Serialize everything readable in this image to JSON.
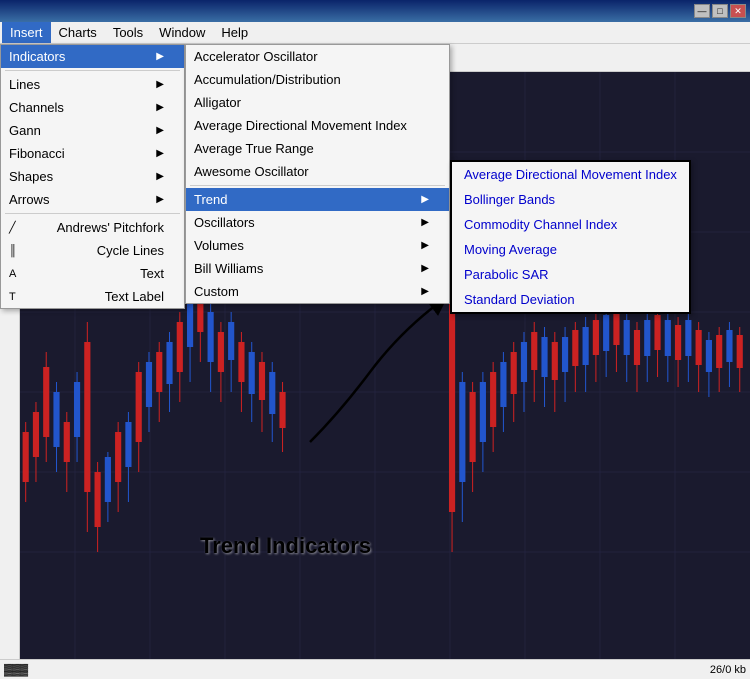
{
  "titleBar": {
    "title": "",
    "controls": {
      "minimize": "—",
      "maximize": "□",
      "close": "✕"
    }
  },
  "menuBar": {
    "items": [
      {
        "id": "insert",
        "label": "Insert",
        "active": true
      },
      {
        "id": "charts",
        "label": "Charts"
      },
      {
        "id": "tools",
        "label": "Tools"
      },
      {
        "id": "window",
        "label": "Window"
      },
      {
        "id": "help",
        "label": "Help"
      }
    ]
  },
  "insertMenu": {
    "items": [
      {
        "id": "indicators",
        "label": "Indicators",
        "hasArrow": true,
        "selected": true
      },
      {
        "id": "sep1",
        "type": "sep"
      },
      {
        "id": "lines",
        "label": "Lines",
        "hasArrow": true
      },
      {
        "id": "channels",
        "label": "Channels",
        "hasArrow": true
      },
      {
        "id": "gann",
        "label": "Gann",
        "hasArrow": true
      },
      {
        "id": "fibonacci",
        "label": "Fibonacci",
        "hasArrow": true
      },
      {
        "id": "shapes",
        "label": "Shapes",
        "hasArrow": true
      },
      {
        "id": "arrows",
        "label": "Arrows",
        "hasArrow": true
      },
      {
        "id": "sep2",
        "type": "sep"
      },
      {
        "id": "pitchfork",
        "label": "Andrews' Pitchfork",
        "icon": "╱"
      },
      {
        "id": "cycle",
        "label": "Cycle Lines",
        "icon": "║"
      },
      {
        "id": "text",
        "label": "Text",
        "icon": "A"
      },
      {
        "id": "textlabel",
        "label": "Text Label",
        "icon": "T"
      }
    ]
  },
  "indicatorsMenu": {
    "items": [
      {
        "id": "accelerator",
        "label": "Accelerator Oscillator"
      },
      {
        "id": "accumulation",
        "label": "Accumulation/Distribution"
      },
      {
        "id": "alligator",
        "label": "Alligator"
      },
      {
        "id": "admi",
        "label": "Average Directional Movement Index"
      },
      {
        "id": "atr",
        "label": "Average True Range"
      },
      {
        "id": "awesome",
        "label": "Awesome Oscillator"
      },
      {
        "id": "sep1",
        "type": "sep"
      },
      {
        "id": "trend",
        "label": "Trend",
        "hasArrow": true,
        "selected": true
      },
      {
        "id": "oscillators",
        "label": "Oscillators",
        "hasArrow": true
      },
      {
        "id": "volumes",
        "label": "Volumes",
        "hasArrow": true
      },
      {
        "id": "billwilliams",
        "label": "Bill Williams",
        "hasArrow": true
      },
      {
        "id": "custom",
        "label": "Custom",
        "hasArrow": true
      }
    ]
  },
  "trendMenu": {
    "items": [
      {
        "id": "admi",
        "label": "Average Directional Movement Index"
      },
      {
        "id": "bollinger",
        "label": "Bollinger Bands"
      },
      {
        "id": "cci",
        "label": "Commodity Channel Index"
      },
      {
        "id": "ma",
        "label": "Moving Average"
      },
      {
        "id": "psar",
        "label": "Parabolic SAR"
      },
      {
        "id": "stddev",
        "label": "Standard Deviation"
      }
    ]
  },
  "annotation": {
    "text": "Trend Indicators"
  },
  "statusBar": {
    "info": "26/0 kb"
  }
}
